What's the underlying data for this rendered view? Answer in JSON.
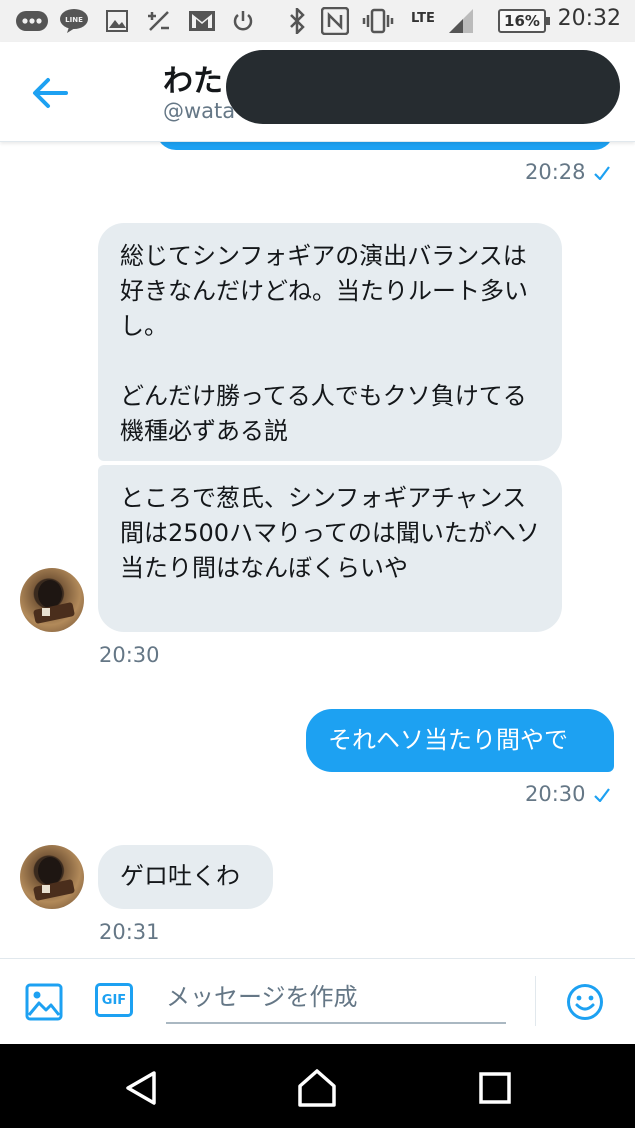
{
  "status_bar": {
    "time": "20:32",
    "battery": "16%",
    "network": "LTE",
    "icons": [
      "more-icon",
      "line-icon",
      "image-icon",
      "data-saver-icon",
      "gmail-icon",
      "power-icon",
      "bluetooth-icon",
      "nfc-icon",
      "vibrate-icon",
      "signal-icon"
    ]
  },
  "header": {
    "name_visible": "わた",
    "handle_visible": "@wata",
    "back_icon": "arrow-left-icon"
  },
  "colors": {
    "accent": "#1da1f2",
    "bubble_in": "#e6ecf0",
    "muted_text": "#657786"
  },
  "messages": [
    {
      "direction": "out",
      "time": "20:28",
      "read": true
    },
    {
      "direction": "in",
      "text": "総じてシンフォギアの演出バランスは好きなんだけどね。当たりルート多いし。\n\nどんだけ勝ってる人でもクソ負けてる機種必ずある説"
    },
    {
      "direction": "in",
      "text": "ところで葱氏、シンフォギアチャンス間は2500ハマりってのは聞いたがヘソ当たり間はなんぼくらいや",
      "time": "20:30"
    },
    {
      "direction": "out",
      "text": "それヘソ当たり間やで",
      "time": "20:30",
      "read": true
    },
    {
      "direction": "in",
      "text": "ゲロ吐くわ",
      "time": "20:31"
    }
  ],
  "composer": {
    "placeholder": "メッセージを作成",
    "gif_label": "GIF",
    "icons": [
      "image-icon",
      "gif-icon",
      "emoji-icon"
    ]
  },
  "nav": {
    "icons": [
      "back-triangle-icon",
      "home-circle-icon",
      "recents-square-icon"
    ]
  }
}
